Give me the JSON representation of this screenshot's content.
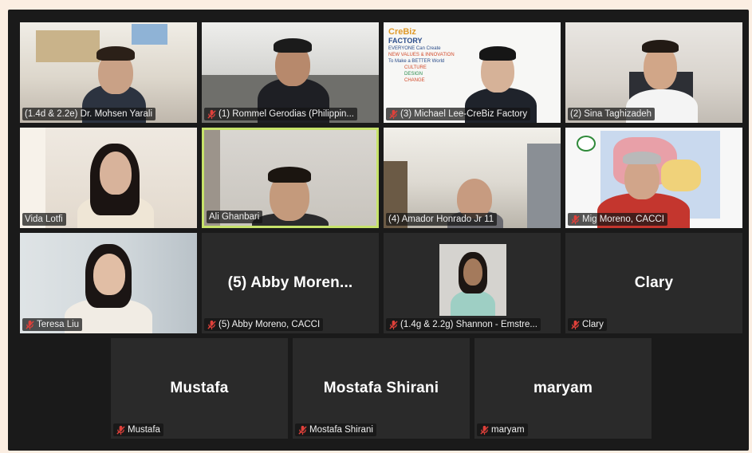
{
  "participants": [
    {
      "label": "(1.4d & 2.2e) Dr. Mohsen Yarali",
      "muted": false
    },
    {
      "label": "(1) Rommel Gerodias (Philippin...",
      "muted": true
    },
    {
      "label": "(3) Michael Lee-CreBiz Factory",
      "muted": true
    },
    {
      "label": "(2) Sina Taghizadeh",
      "muted": false
    },
    {
      "label": "Vida Lotfi",
      "muted": false
    },
    {
      "label": "Ali Ghanbari",
      "muted": false
    },
    {
      "label": "(4) Amador Honrado Jr 11",
      "muted": false
    },
    {
      "label": "Mig Moreno, CACCI",
      "muted": true
    },
    {
      "label": "Teresa Liu",
      "muted": true
    },
    {
      "label": "(5) Abby Moreno, CACCI",
      "display": "(5) Abby Moren...",
      "muted": true
    },
    {
      "label": "(1.4g & 2.2g) Shannon - Emstre...",
      "muted": true
    },
    {
      "label": "Clary",
      "display": "Clary",
      "muted": true
    },
    {
      "label": "Mustafa",
      "display": "Mustafa",
      "muted": true
    },
    {
      "label": "Mostafa Shirani",
      "display": "Mostafa Shirani",
      "muted": true
    },
    {
      "label": "maryam",
      "display": "maryam",
      "muted": true
    }
  ],
  "slide": {
    "brand": "CreBiz",
    "brand_sub": "FACTORY",
    "line1": "EVERYONE Can Create",
    "line2": "NEW VALUES & INNOVATION",
    "line3": "To Make a BETTER World",
    "line4": "CULTURE",
    "line5": "DESIGN",
    "line6": "CHANGE"
  },
  "colors": {
    "background": "#fbeee2",
    "window": "#1a1a1a",
    "tile_empty": "#2a2a2a",
    "active_speaker_border": "#c7e36b",
    "mute_icon": "#e0403a"
  }
}
